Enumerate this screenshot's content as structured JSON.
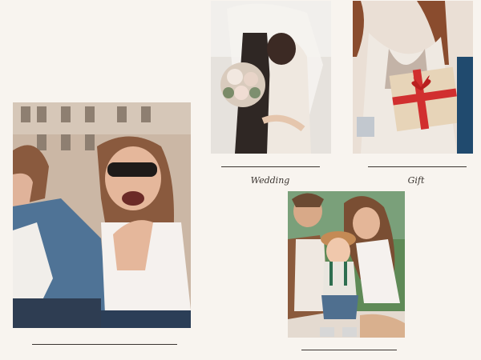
{
  "gallery": {
    "items": [
      {
        "id": "wedding",
        "caption": "Wedding"
      },
      {
        "id": "gift",
        "caption": "Gift"
      },
      {
        "id": "couple",
        "caption": ""
      },
      {
        "id": "family",
        "caption": ""
      }
    ]
  },
  "colors": {
    "background": "#f8f4ef",
    "rule": "#3a3430",
    "caption_text": "#3a3430"
  }
}
